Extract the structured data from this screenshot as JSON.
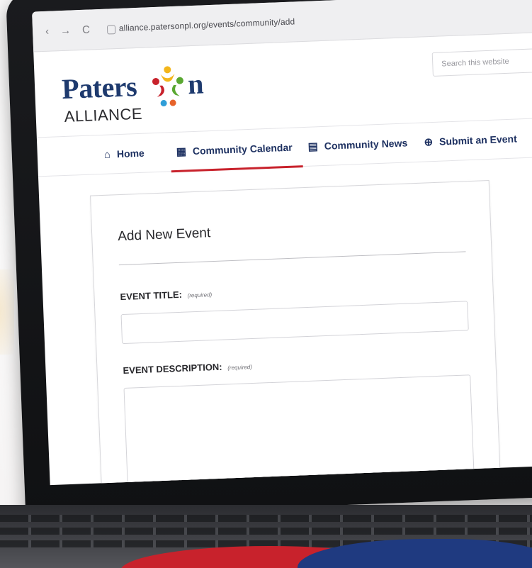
{
  "browser": {
    "back_glyph": "‹",
    "forward_glyph": "→",
    "reload_glyph": "C",
    "url": "alliance.patersonpl.org/events/community/add"
  },
  "site": {
    "logo_word_prefix": "Paters",
    "logo_word_suffix": "n",
    "logo_subword": "ALLIANCE",
    "search_placeholder": "Search this website"
  },
  "nav": {
    "items": [
      {
        "label": "Home",
        "icon": "home-icon",
        "glyph": "⌂"
      },
      {
        "label": "Community Calendar",
        "icon": "calendar-icon",
        "glyph": "▦"
      },
      {
        "label": "Community News",
        "icon": "newspaper-icon",
        "glyph": "▤"
      },
      {
        "label": "Submit an Event",
        "icon": "plus-circle-icon",
        "glyph": "⊕"
      }
    ],
    "active_index": 1
  },
  "form": {
    "title": "Add New Event",
    "fields": [
      {
        "label": "EVENT TITLE:",
        "required_note": "(required)",
        "value": ""
      },
      {
        "label": "EVENT DESCRIPTION:",
        "required_note": "(required)",
        "value": ""
      }
    ]
  },
  "colors": {
    "brand_navy": "#1f3262",
    "accent_red": "#c8222c",
    "logo_yellow": "#f3b61b",
    "logo_green": "#5aa832",
    "logo_blue": "#2f9ed8",
    "logo_orange": "#e6632a"
  }
}
